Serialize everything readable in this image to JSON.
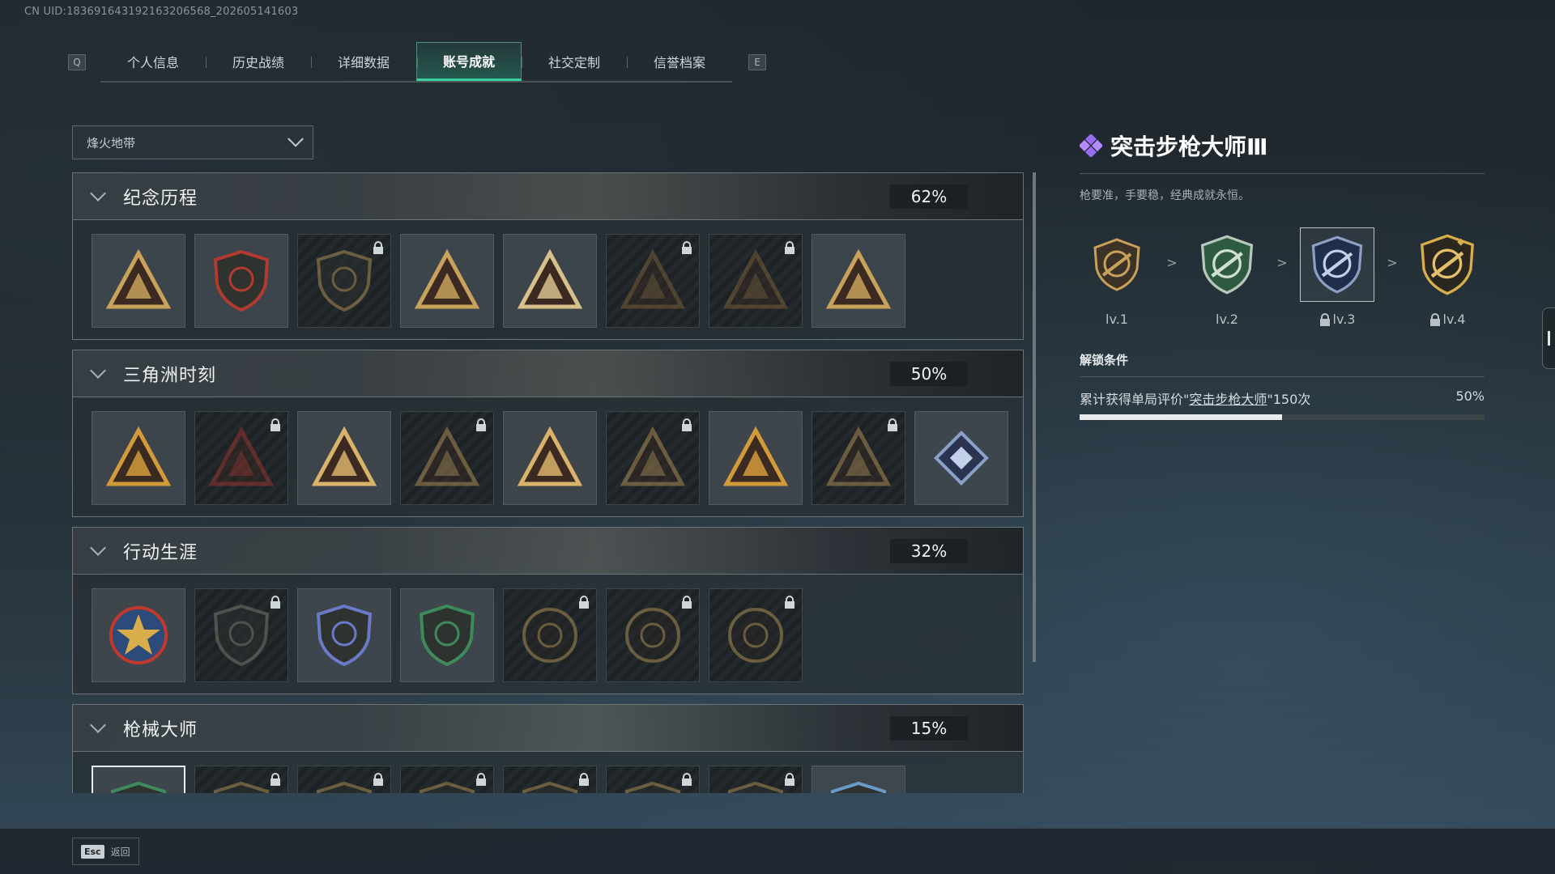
{
  "uid": "CN UID:18369164319216320656​8_202605141603",
  "tabs": {
    "left_key": "Q",
    "right_key": "E",
    "items": [
      {
        "label": "个人信息"
      },
      {
        "label": "历史战绩"
      },
      {
        "label": "详细数据"
      },
      {
        "label": "账号成就"
      },
      {
        "label": "社交定制"
      },
      {
        "label": "信誉档案"
      }
    ],
    "active_index": 3
  },
  "mode_select": {
    "value": "烽火地带"
  },
  "sections": [
    {
      "title": "纪念历程",
      "percent": "62%",
      "locked": [
        false,
        false,
        true,
        false,
        false,
        true,
        true,
        false
      ]
    },
    {
      "title": "三角洲时刻",
      "percent": "50%",
      "locked": [
        false,
        true,
        false,
        true,
        false,
        true,
        false,
        true,
        false
      ]
    },
    {
      "title": "行动生涯",
      "percent": "32%",
      "locked": [
        false,
        true,
        false,
        false,
        true,
        true,
        true
      ]
    },
    {
      "title": "枪械大师",
      "percent": "15%",
      "locked": [
        false,
        true,
        true,
        true,
        true,
        true,
        true,
        false
      ]
    }
  ],
  "detail": {
    "title": "突击步枪大师Ⅲ",
    "description": "枪要准，手要稳，经典成就永恒。",
    "levels": [
      {
        "label": "lv.1",
        "locked": false
      },
      {
        "label": "lv.2",
        "locked": false
      },
      {
        "label": "lv.3",
        "locked": true
      },
      {
        "label": "lv.4",
        "locked": true
      }
    ],
    "separator": ">",
    "unlock_header": "解锁条件",
    "condition_prefix": "累计获得单局评价\"",
    "condition_link": "突击步枪大师",
    "condition_suffix": "\"150次",
    "condition_percent": "50%",
    "progress": 0.5
  },
  "footer": {
    "esc_key": "Esc",
    "back_label": "返回"
  },
  "colors": {
    "accent": "#39d0a0",
    "gold": "#c8a15a",
    "green": "#3f8a5a",
    "purple": "#9a6cf0"
  }
}
